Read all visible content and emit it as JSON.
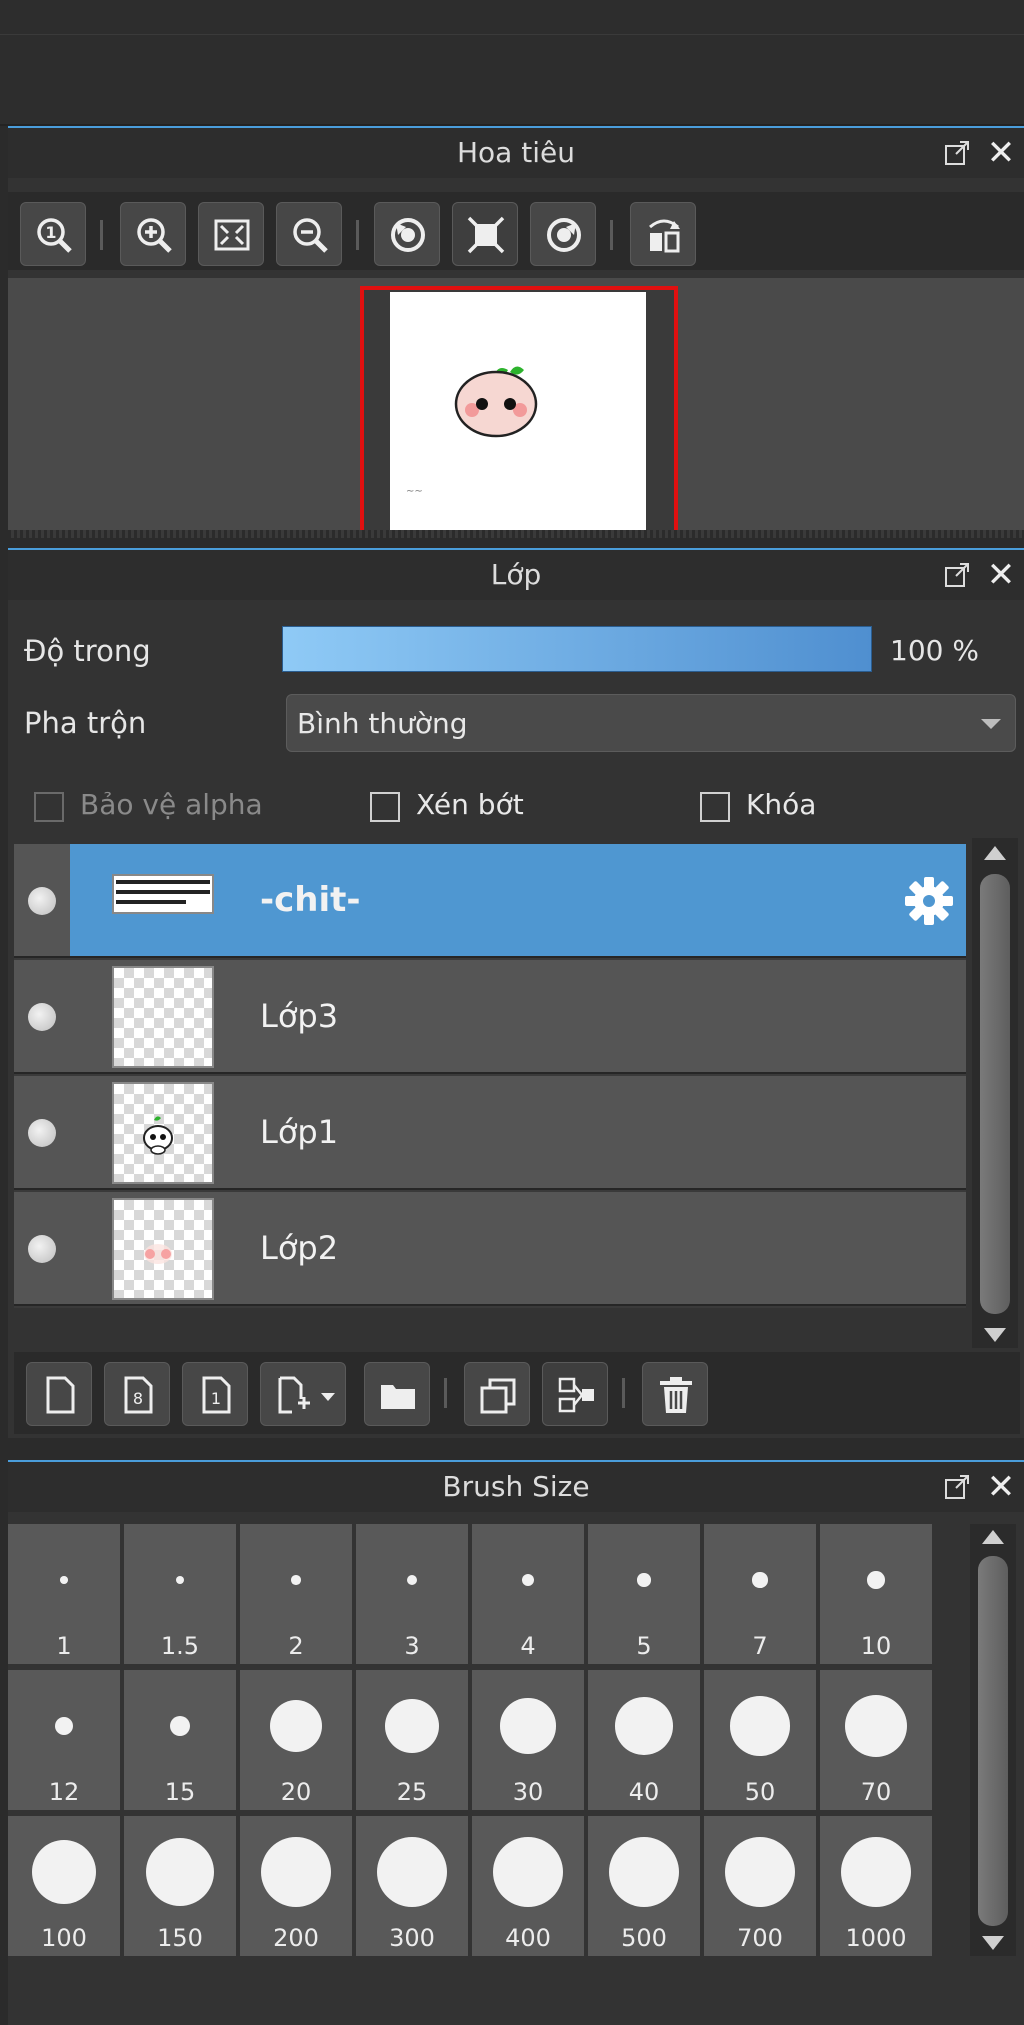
{
  "navigator": {
    "title": "Hoa tiêu",
    "toolbar": [
      "zoom-actual-icon",
      "zoom-in-icon",
      "fit-screen-icon",
      "zoom-out-icon",
      "rotate-left-icon",
      "fit-window-icon",
      "rotate-right-icon",
      "flip-horizontal-icon"
    ]
  },
  "layer_panel": {
    "title": "Lớp",
    "opacity_label": "Độ trong",
    "opacity_value": "100 %",
    "opacity_percent": 100,
    "blend_label": "Pha trộn",
    "blend_value": "Bình thường",
    "protect_alpha": "Bảo vệ alpha",
    "clipping": "Xén bớt",
    "lock": "Khóa",
    "layers": [
      {
        "name": "-chit-",
        "selected": true
      },
      {
        "name": "Lớp3",
        "selected": false
      },
      {
        "name": "Lớp1",
        "selected": false
      },
      {
        "name": "Lớp2",
        "selected": false
      }
    ],
    "toolbar": [
      "new-layer-icon",
      "new-8bit-layer-icon",
      "new-1bit-layer-icon",
      "add-layer-menu-icon",
      "folder-icon",
      "duplicate-layer-icon",
      "merge-down-icon",
      "delete-layer-icon"
    ]
  },
  "brush_panel": {
    "title": "Brush Size",
    "sizes": [
      "1",
      "1.5",
      "2",
      "3",
      "4",
      "5",
      "7",
      "10",
      "12",
      "15",
      "20",
      "25",
      "30",
      "40",
      "50",
      "70",
      "100",
      "150",
      "200",
      "300",
      "400",
      "500",
      "700",
      "1000"
    ]
  },
  "colors": {
    "accent": "#4a9ddb",
    "selected_row": "#4f97d1",
    "navigator_frame": "#e01010"
  }
}
